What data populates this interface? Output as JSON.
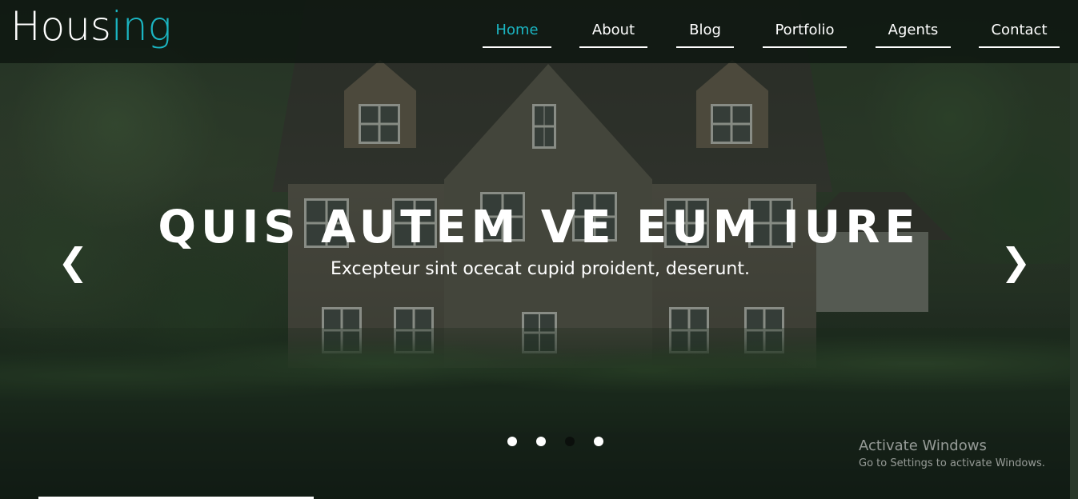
{
  "brand": {
    "logo_main": "Hous",
    "logo_accent": "ing",
    "accent_color": "#1bb5c2"
  },
  "nav": {
    "items": [
      {
        "label": "Home",
        "active": true
      },
      {
        "label": "About",
        "active": false
      },
      {
        "label": "Blog",
        "active": false
      },
      {
        "label": "Portfolio",
        "active": false
      },
      {
        "label": "Agents",
        "active": false
      },
      {
        "label": "Contact",
        "active": false
      }
    ]
  },
  "hero": {
    "headline": "QUIS AUTEM VE EUM IURE",
    "subline": "Excepteur sint ocecat cupid proident, deserunt.",
    "prev_icon": "❮",
    "next_icon": "❯",
    "slides_count": 4,
    "active_slide": 3
  },
  "watermark": {
    "title": "Activate Windows",
    "subtitle": "Go to Settings to activate Windows."
  }
}
